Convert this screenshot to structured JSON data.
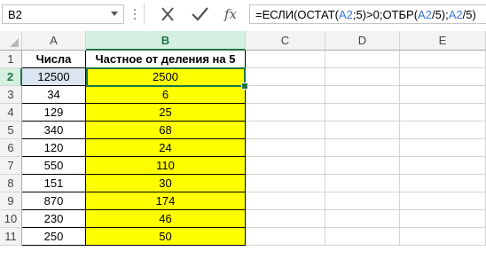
{
  "name_box": {
    "value": "B2"
  },
  "formula_bar": {
    "parts": [
      {
        "text": "=ЕСЛИ(ОСТАТ(",
        "style": "plain"
      },
      {
        "text": "A2",
        "style": "blue"
      },
      {
        "text": ";5)>0;ОТБР(",
        "style": "plain"
      },
      {
        "text": "A2",
        "style": "blue"
      },
      {
        "text": "/5);",
        "style": "plain"
      },
      {
        "text": "A2",
        "style": "blue"
      },
      {
        "text": "/5)",
        "style": "plain"
      }
    ],
    "icons": [
      "cancel-icon",
      "enter-icon",
      "fx-icon"
    ]
  },
  "columns": [
    "A",
    "B",
    "C",
    "D",
    "E"
  ],
  "active_column": "B",
  "active_row": "2",
  "rows": [
    {
      "num": "1",
      "a": "Числа",
      "b": "Частное от деления на 5",
      "header": true
    },
    {
      "num": "2",
      "a": "12500",
      "b": "2500"
    },
    {
      "num": "3",
      "a": "34",
      "b": "6"
    },
    {
      "num": "4",
      "a": "129",
      "b": "25"
    },
    {
      "num": "5",
      "a": "340",
      "b": "68"
    },
    {
      "num": "6",
      "a": "120",
      "b": "24"
    },
    {
      "num": "7",
      "a": "550",
      "b": "110"
    },
    {
      "num": "8",
      "a": "151",
      "b": "30"
    },
    {
      "num": "9",
      "a": "870",
      "b": "174"
    },
    {
      "num": "10",
      "a": "230",
      "b": "46"
    },
    {
      "num": "11",
      "a": "250",
      "b": "50"
    }
  ],
  "colors": {
    "highlight": "#ffff00",
    "selection": "#217346",
    "ref_blue": "#3c78d8"
  }
}
